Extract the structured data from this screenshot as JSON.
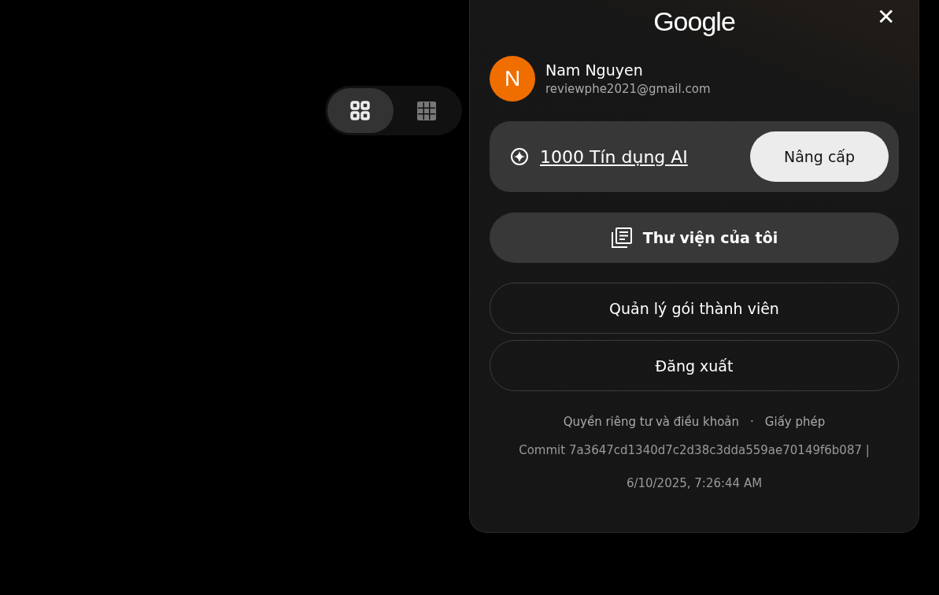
{
  "view_toggle": [
    {
      "kind": "grid-large",
      "selected": true
    },
    {
      "kind": "grid-small",
      "selected": false
    }
  ],
  "account_panel": {
    "logo": "Google",
    "close": "✕",
    "user": {
      "initial": "N",
      "name": "Nam Nguyen",
      "email": "reviewphe2021@gmail.com"
    },
    "credits": {
      "label": "1000 Tín dụng AI",
      "upgrade": "Nâng cấp"
    },
    "library_button": "Thư viện của tôi",
    "buttons": [
      "Quản lý gói thành viên",
      "Đăng xuất"
    ],
    "links": [
      "Quyền riêng tư và điều khoản",
      "Giấy phép"
    ],
    "separator": "·",
    "commit": "Commit 7a3647cd1340d7c2d38c3dda559ae70149f6b087 |",
    "timestamp": "6/10/2025, 7:26:44 AM"
  }
}
